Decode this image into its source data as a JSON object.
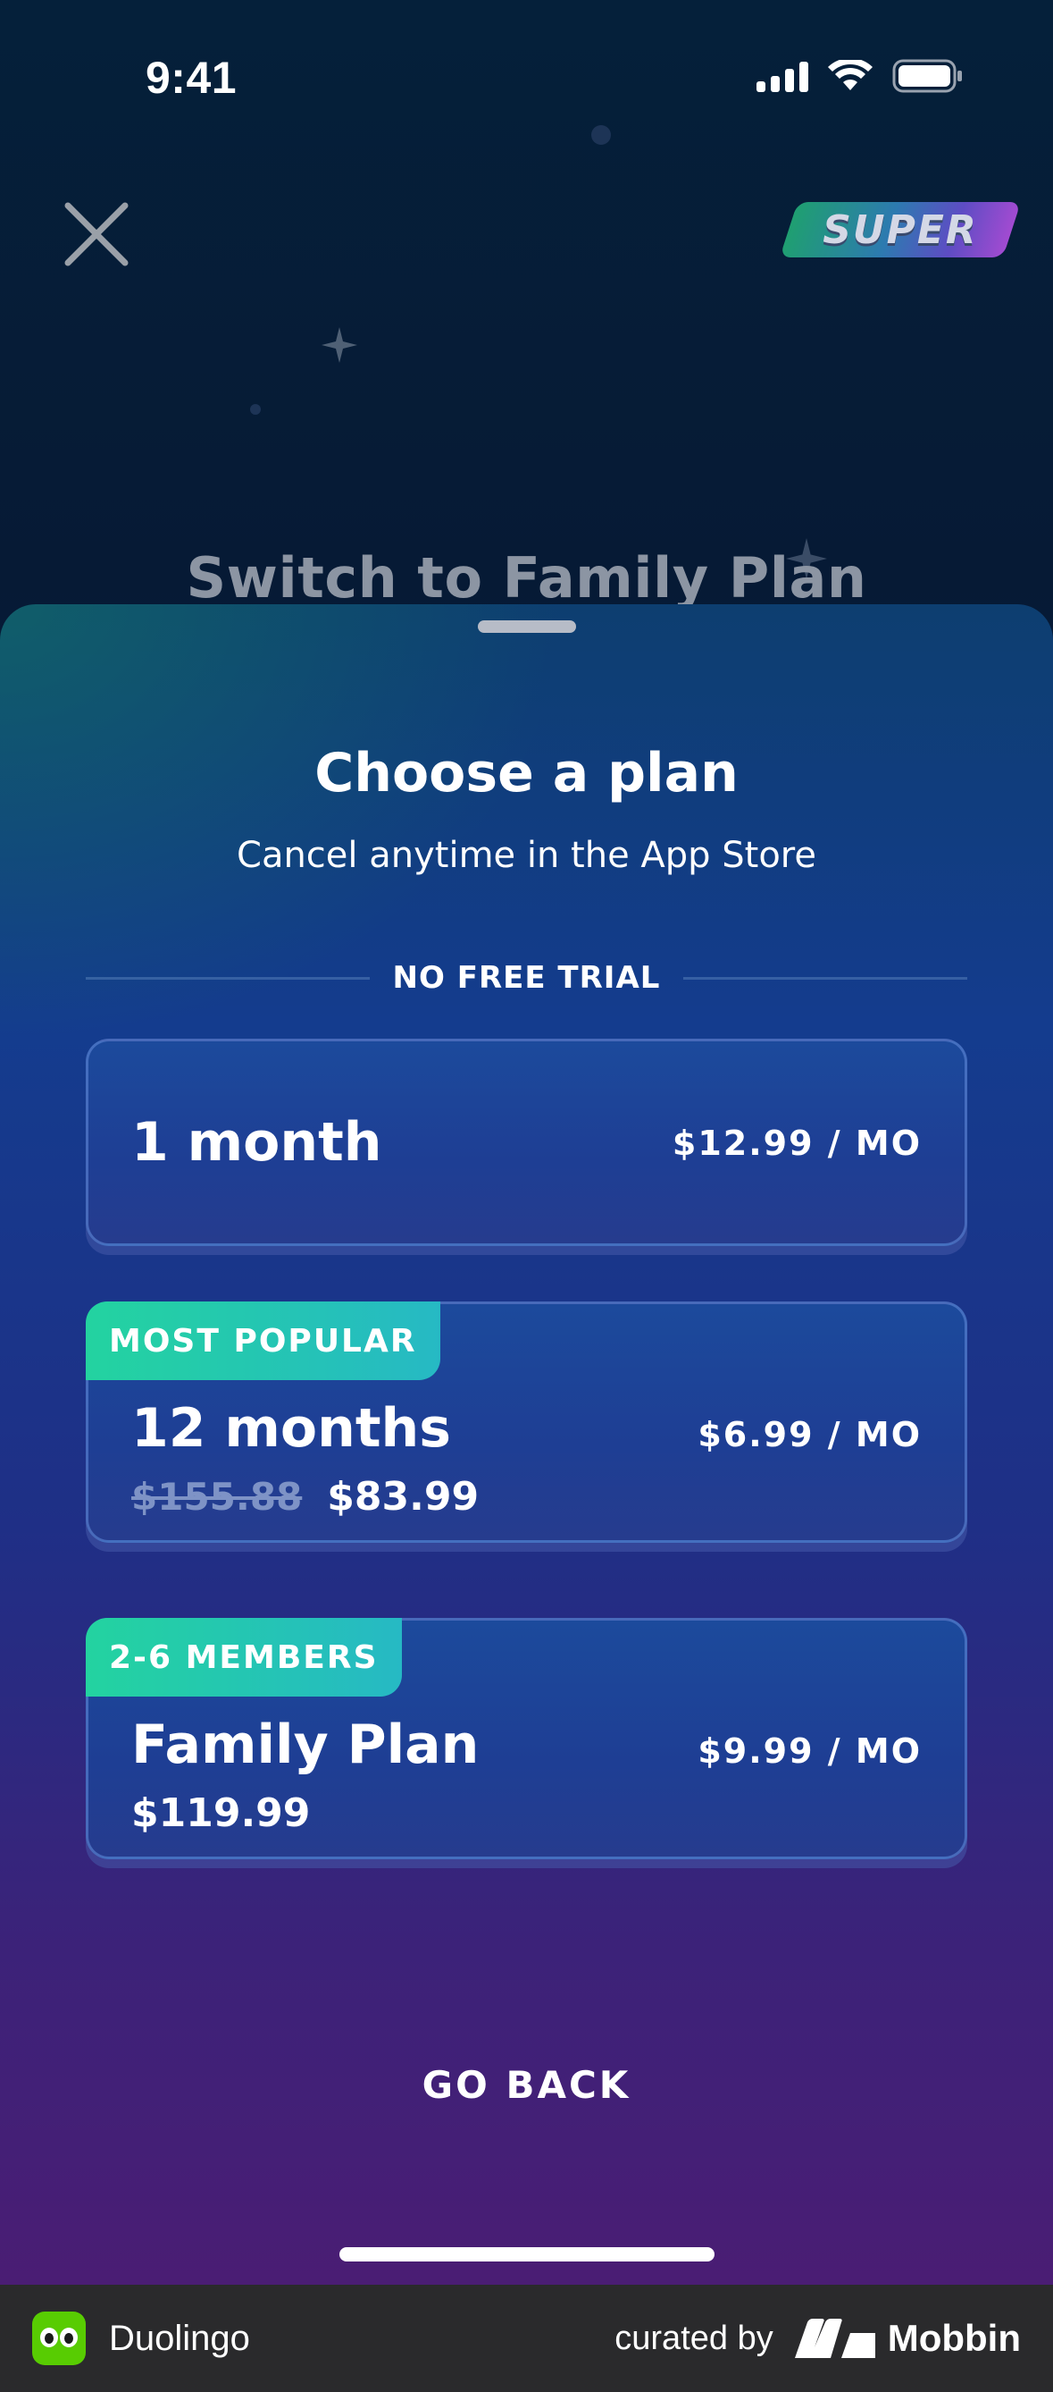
{
  "status_bar": {
    "time": "9:41"
  },
  "header": {
    "badge": "SUPER"
  },
  "background": {
    "title": "Switch to Family Plan"
  },
  "sheet": {
    "title": "Choose a plan",
    "subtitle": "Cancel anytime in the App Store",
    "divider_label": "NO FREE TRIAL",
    "plans": [
      {
        "name": "1 month",
        "price": "$12.99 / MO"
      },
      {
        "ribbon": "MOST POPULAR",
        "name": "12 months",
        "price": "$6.99 / MO",
        "old_total": "$155.88",
        "total": "$83.99"
      },
      {
        "ribbon": "2-6 MEMBERS",
        "name": "Family Plan",
        "price": "$9.99 / MO",
        "total": "$119.99"
      }
    ],
    "go_back": "GO BACK"
  },
  "footer": {
    "app_name": "Duolingo",
    "curated_by": "curated by",
    "brand": "Mobbin"
  },
  "colors": {
    "ribbon": "#23d3a0",
    "card": "#1e3e94",
    "footer": "#2a2a2c",
    "brand_green": "#58cc02"
  }
}
